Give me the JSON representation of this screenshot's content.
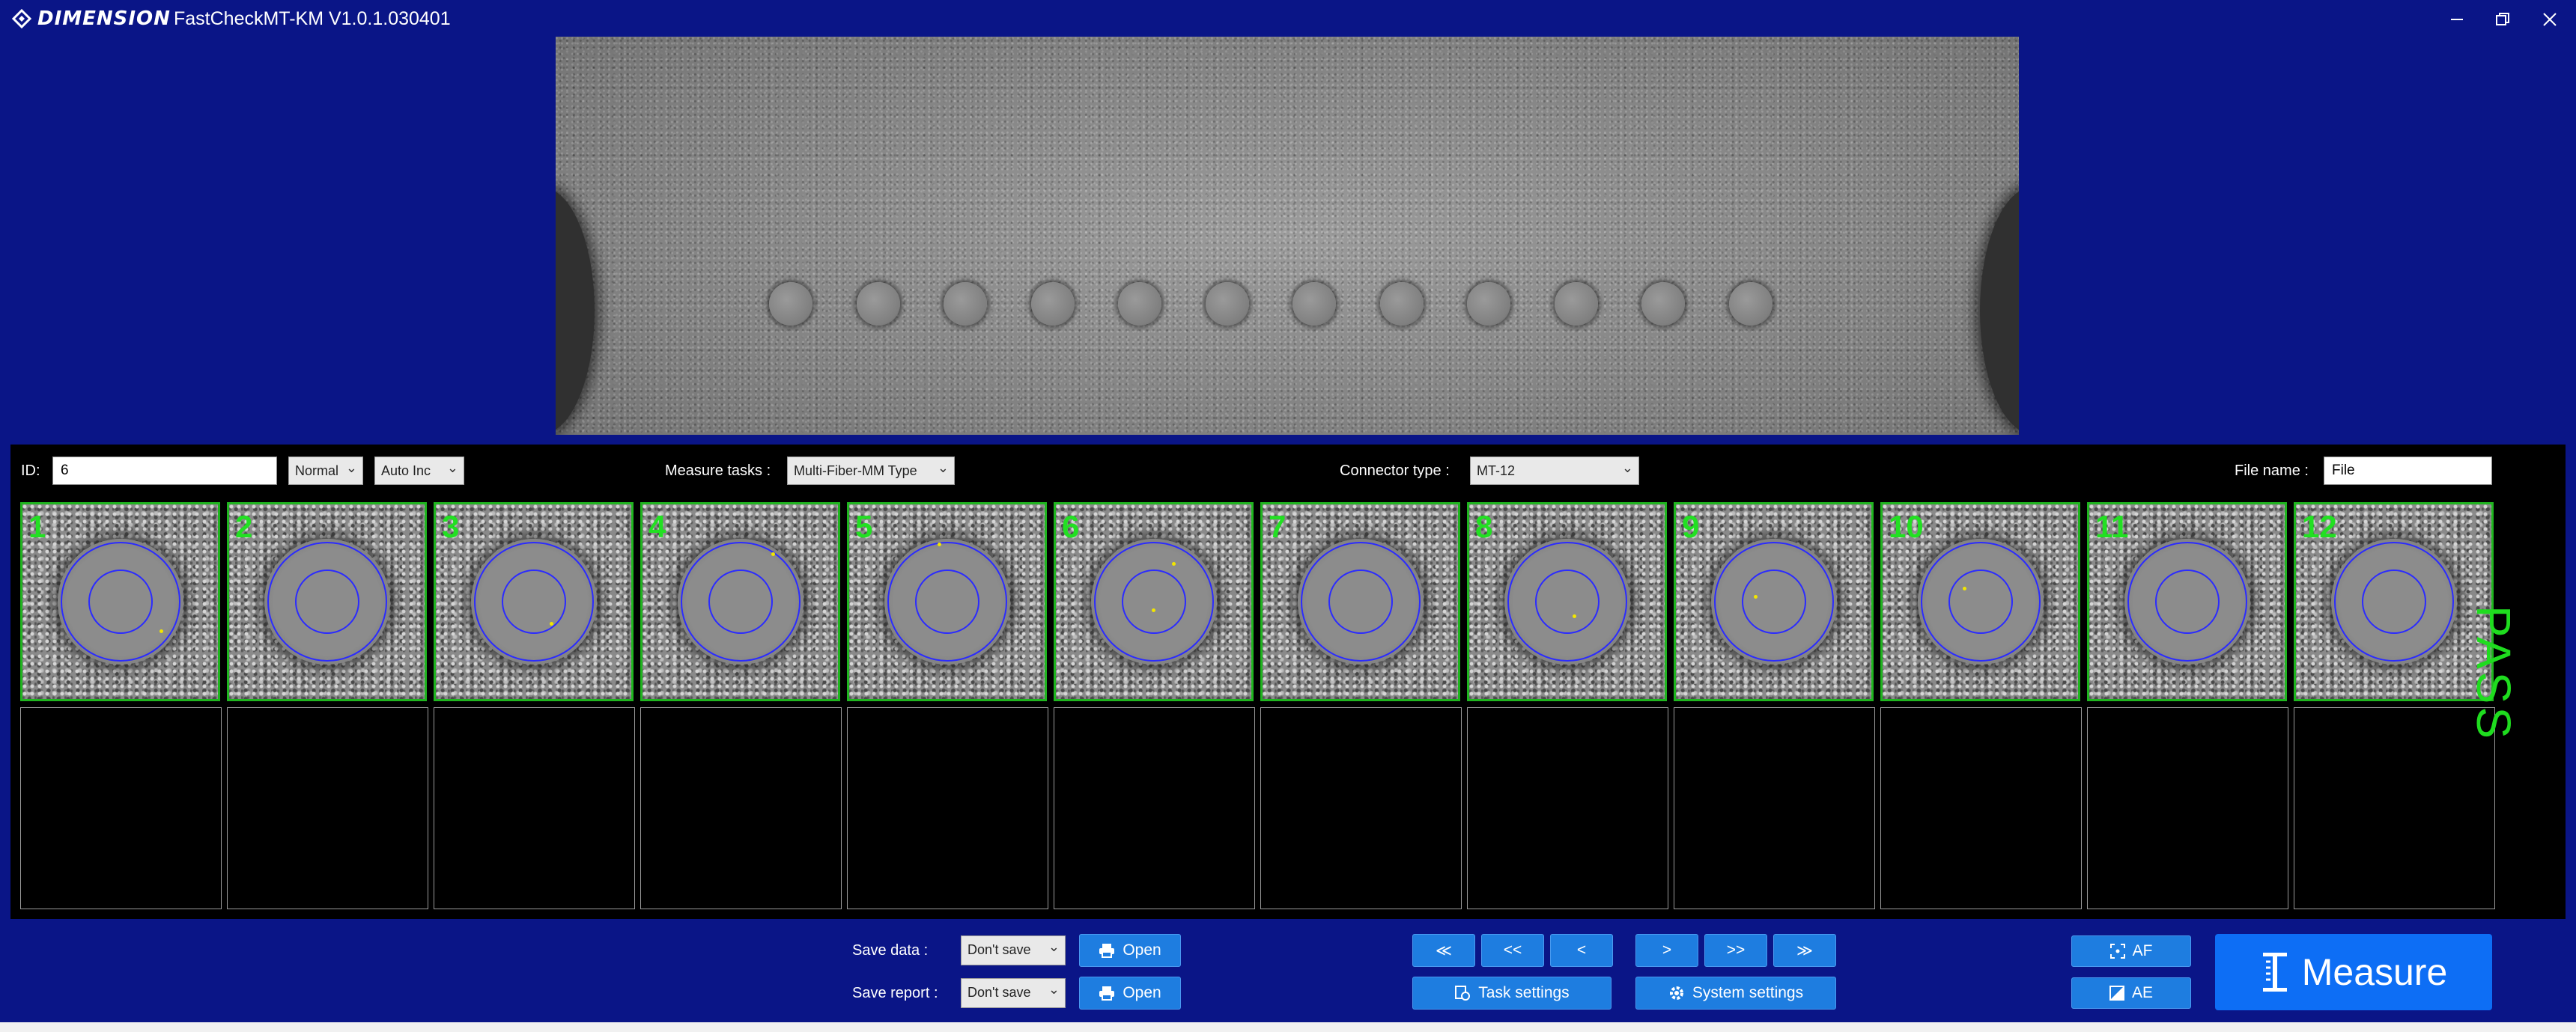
{
  "titlebar": {
    "brand": "DIMENSION",
    "title": "FastCheckMT-KM V1.0.1.030401",
    "icons": [
      "minimize-icon",
      "restore-icon",
      "close-icon"
    ]
  },
  "controls": {
    "id_label": "ID:",
    "id_value": "6",
    "mode_select": "Normal",
    "increment_select": "Auto Inc",
    "measure_tasks_label": "Measure tasks :",
    "measure_tasks_value": "Multi-Fiber-MM Type",
    "connector_type_label": "Connector type :",
    "connector_type_value": "MT-12",
    "file_name_label": "File name :",
    "file_name_value": "File"
  },
  "fibers": [
    {
      "label": "1"
    },
    {
      "label": "2"
    },
    {
      "label": "3"
    },
    {
      "label": "4"
    },
    {
      "label": "5"
    },
    {
      "label": "6"
    },
    {
      "label": "7"
    },
    {
      "label": "8"
    },
    {
      "label": "9"
    },
    {
      "label": "10"
    },
    {
      "label": "11"
    },
    {
      "label": "12"
    }
  ],
  "result": "PASS",
  "bottom": {
    "save_data_label": "Save data :",
    "save_data_value": "Don't save",
    "save_report_label": "Save report :",
    "save_report_value": "Don't save",
    "open_label": "Open",
    "nav_first": "≪",
    "nav_prev_fast": "<<",
    "nav_prev": "<",
    "nav_next": ">",
    "nav_next_fast": ">>",
    "nav_last": "≫",
    "task_settings_label": "Task settings",
    "system_settings_label": "System settings",
    "af_label": "AF",
    "ae_label": "AE",
    "measure_label": "Measure"
  },
  "colors": {
    "background": "#0a1587",
    "button": "#1e7de0",
    "measure_button": "#0d6ef5",
    "pass": "#1fdc1f",
    "thumb_border": "#1fb51f"
  }
}
